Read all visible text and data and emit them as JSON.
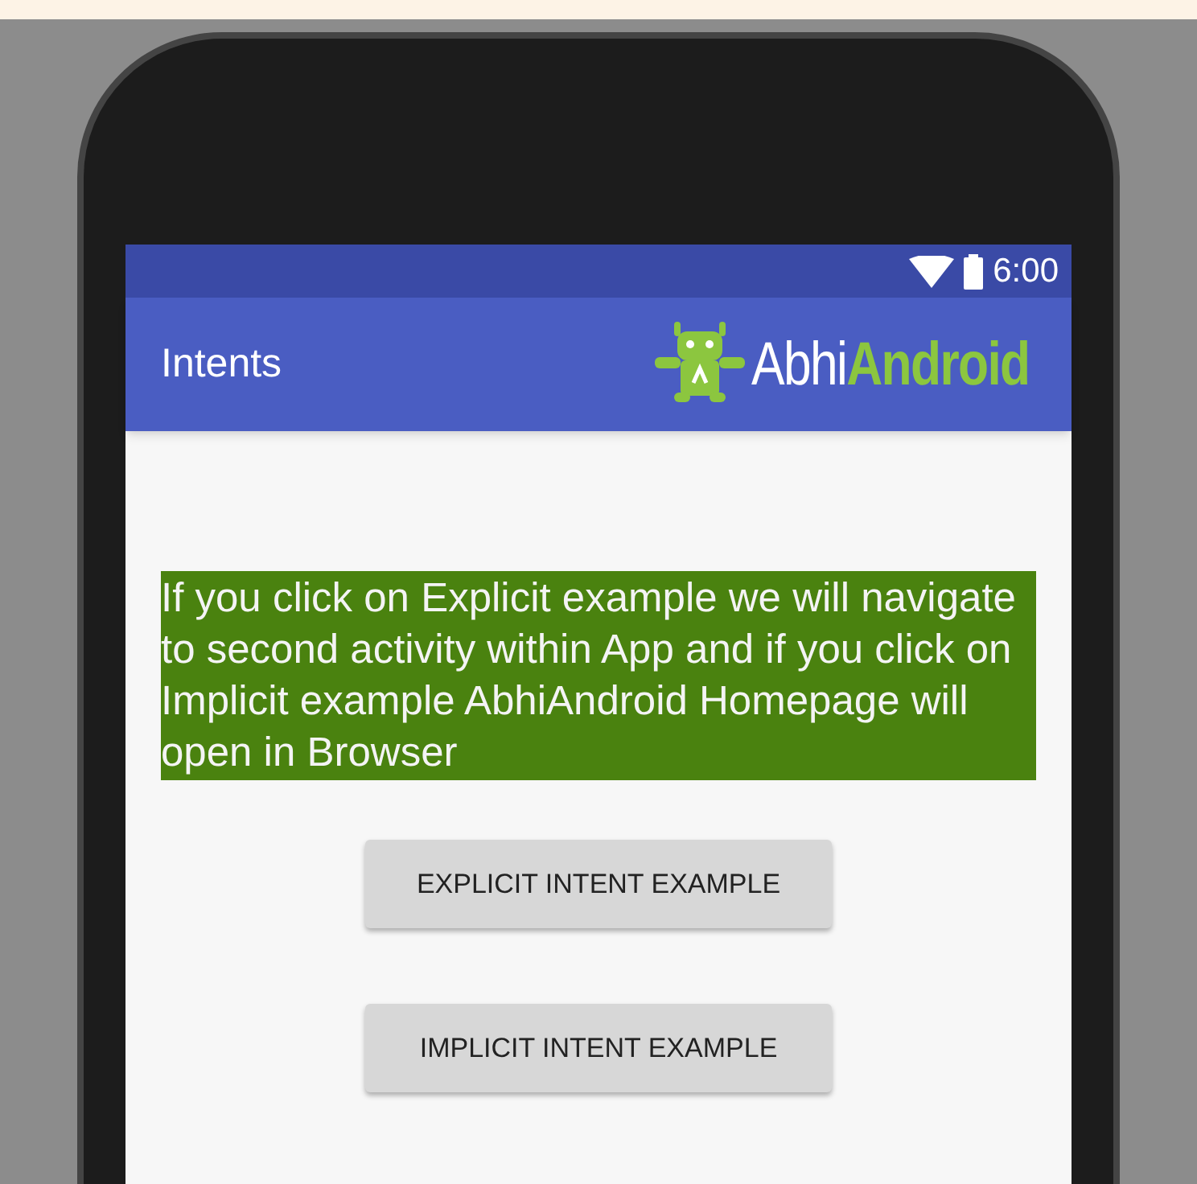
{
  "status_bar": {
    "time": "6:00"
  },
  "app_bar": {
    "title": "Intents",
    "logo": {
      "first_part": "Abhi",
      "second_part": "Android"
    }
  },
  "message": "If you click on Explicit example we will navigate to second activity within App and if you click on Implicit example AbhiAndroid Homepage will open in Browser",
  "buttons": [
    {
      "label": "EXPLICIT INTENT EXAMPLE"
    },
    {
      "label": "IMPLICIT INTENT EXAMPLE"
    }
  ]
}
